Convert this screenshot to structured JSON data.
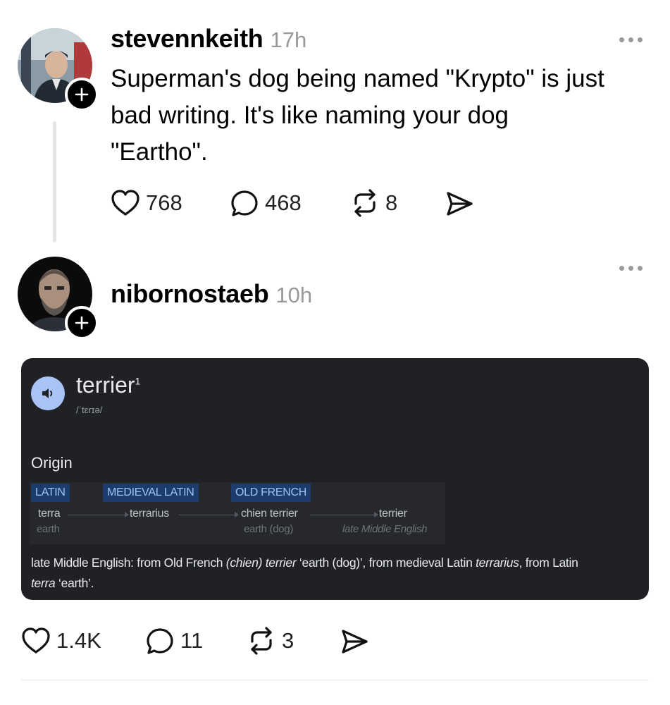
{
  "post1": {
    "username": "stevennkeith",
    "time": "17h",
    "text_line1": "Superman's dog being named \"Krypto\" is just",
    "text_line2": "bad writing. It's like naming your dog",
    "text_line3": "\"Eartho\".",
    "likes": "768",
    "replies": "468",
    "reposts": "8"
  },
  "post2": {
    "username": "nibornostaeb",
    "time": "10h",
    "likes": "1.4K",
    "replies": "11",
    "reposts": "3"
  },
  "dictionary": {
    "word": "terrier",
    "superscript": "1",
    "pronunciation": "/ˈtɛrɪə/",
    "origin_heading": "Origin",
    "languages": [
      "LATIN",
      "MEDIEVAL LATIN",
      "OLD FRENCH"
    ],
    "words": [
      "terra",
      "terrarius",
      "chien terrier",
      "terrier"
    ],
    "glosses": [
      "earth",
      "earth (dog)",
      "late Middle English"
    ],
    "desc": {
      "p1": "late Middle English: from Old French ",
      "p2": "(chien) terrier",
      "p3": " ‘earth (dog)’, from medieval Latin ",
      "p4": "terrarius",
      "p5": ", from Latin",
      "p6": "terra",
      "p7": " ‘earth’."
    }
  },
  "icons": {
    "plus": "plus-icon",
    "more": "more-icon",
    "like": "heart-icon",
    "reply": "comment-icon",
    "repost": "repost-icon",
    "share": "send-icon",
    "speaker": "speaker-icon"
  }
}
